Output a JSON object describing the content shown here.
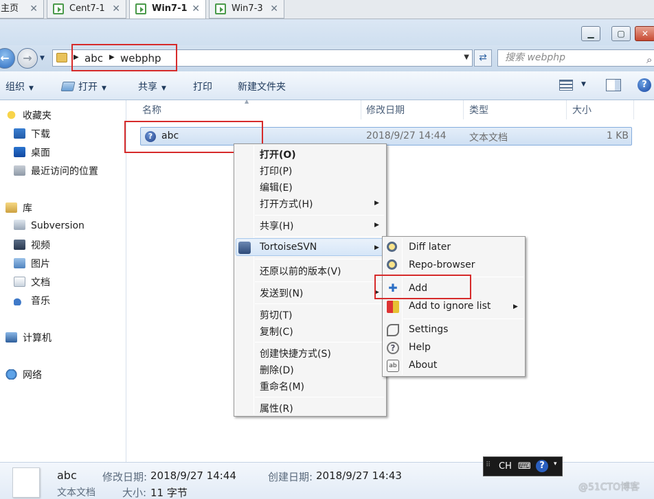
{
  "tabs": [
    {
      "label": "主页"
    },
    {
      "label": "Cent7-1"
    },
    {
      "label": "Win7-1"
    },
    {
      "label": "Win7-3"
    }
  ],
  "address": {
    "crumbs": [
      "abc",
      "webphp"
    ]
  },
  "search": {
    "placeholder": "搜索 webphp"
  },
  "toolbar": {
    "organize": "组织",
    "open": "打开",
    "share": "共享",
    "print": "打印",
    "new_folder": "新建文件夹"
  },
  "nav": {
    "favorites": "收藏夹",
    "downloads": "下载",
    "desktop": "桌面",
    "recent": "最近访问的位置",
    "libraries": "库",
    "subversion": "Subversion",
    "videos": "视频",
    "pictures": "图片",
    "documents": "文档",
    "music": "音乐",
    "computer": "计算机",
    "network": "网络"
  },
  "columns": {
    "name": "名称",
    "modified": "修改日期",
    "type": "类型",
    "size": "大小"
  },
  "file": {
    "name": "abc",
    "modified": "2018/9/27 14:44",
    "type": "文本文档",
    "size": "1 KB"
  },
  "context_menu": {
    "open": "打开(O)",
    "print": "打印(P)",
    "edit": "编辑(E)",
    "open_with": "打开方式(H)",
    "share": "共享(H)",
    "tortoisesvn": "TortoiseSVN",
    "restore": "还原以前的版本(V)",
    "send_to": "发送到(N)",
    "cut": "剪切(T)",
    "copy": "复制(C)",
    "shortcut": "创建快捷方式(S)",
    "delete": "删除(D)",
    "rename": "重命名(M)",
    "properties": "属性(R)"
  },
  "svn_menu": {
    "diff_later": "Diff later",
    "repo_browser": "Repo-browser",
    "add": "Add",
    "add_ignore": "Add to ignore list",
    "settings": "Settings",
    "help": "Help",
    "about": "About"
  },
  "details": {
    "name": "abc",
    "type": "文本文档",
    "modified_label": "修改日期:",
    "modified": "2018/9/27 14:44",
    "created_label": "创建日期:",
    "created": "2018/9/27 14:43",
    "size_label": "大小:",
    "size": "11 字节"
  },
  "ime": {
    "lang": "CH"
  },
  "watermark": "@51CTO博客"
}
